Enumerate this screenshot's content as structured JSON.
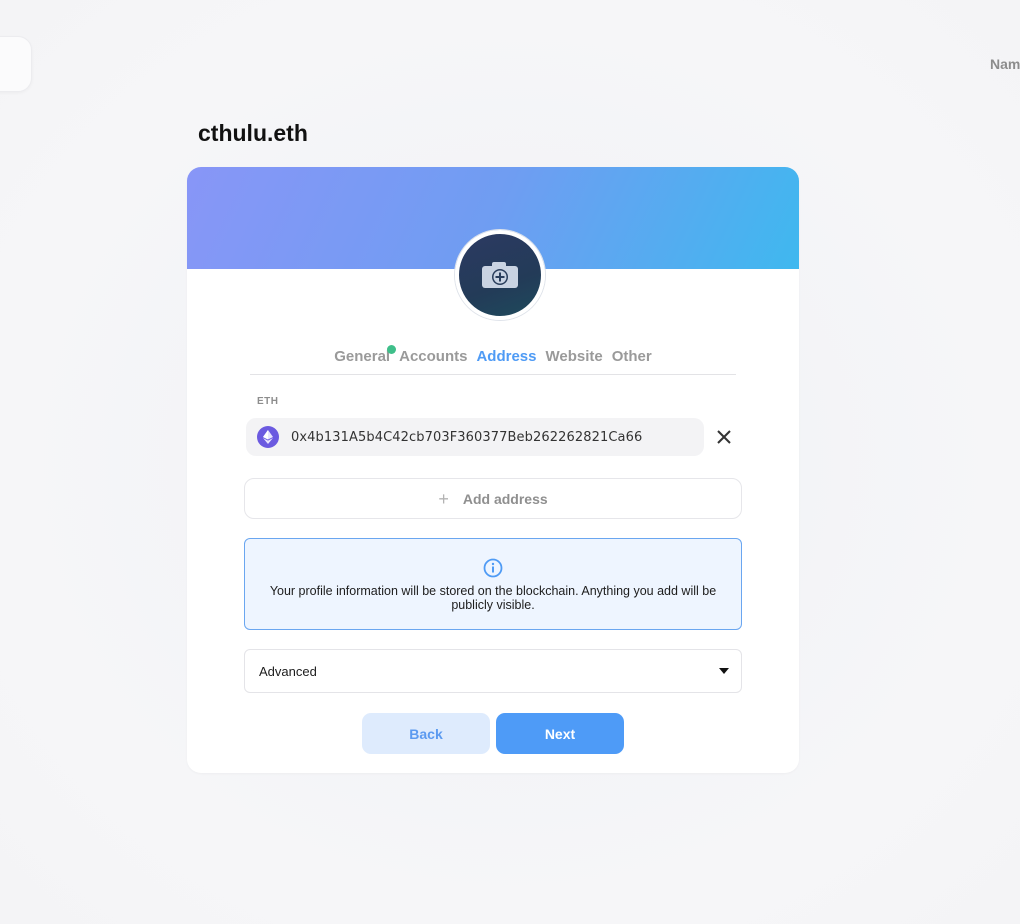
{
  "page": {
    "title": "cthulu.eth",
    "top_right_label": "Nam"
  },
  "tabs": [
    {
      "label": "General",
      "active": false,
      "has_dot": true
    },
    {
      "label": "Accounts",
      "active": false,
      "has_dot": false
    },
    {
      "label": "Address",
      "active": true,
      "has_dot": false
    },
    {
      "label": "Website",
      "active": false,
      "has_dot": false
    },
    {
      "label": "Other",
      "active": false,
      "has_dot": false
    }
  ],
  "address_section": {
    "label": "ETH",
    "icon": "ethereum-icon",
    "value": "0x4b131A5b4C42cb703F360377Beb262262821Ca66"
  },
  "add_address": {
    "label": "Add address",
    "icon": "plus-icon"
  },
  "info": {
    "icon": "info-icon",
    "text": "Your profile information will be stored on the blockchain. Anything you add will be publicly visible."
  },
  "advanced": {
    "label": "Advanced",
    "icon": "caret-down-icon"
  },
  "buttons": {
    "back": "Back",
    "next": "Next"
  },
  "colors": {
    "accent": "#4e9bf7",
    "banner_start": "#8896f7",
    "banner_end": "#3fb8ef",
    "status_dot": "#3fbf8a",
    "eth_purple": "#6b5ae0"
  }
}
